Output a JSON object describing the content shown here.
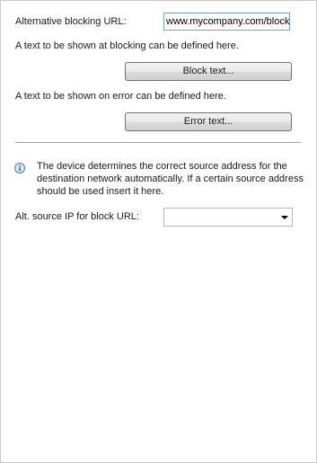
{
  "alt_blocking_url": {
    "label": "Alternative blocking URL:",
    "value": "www.mycompany.com/block"
  },
  "block_section": {
    "description": "A text to be shown at blocking can be defined here.",
    "button_label": "Block text..."
  },
  "error_section": {
    "description": "A text to be shown on error can be defined here.",
    "button_label": "Error text..."
  },
  "info": {
    "icon": "info-icon",
    "text": "The device determines the correct source address for the destination network automatically. If a certain source address should be used insert it here."
  },
  "alt_source_ip": {
    "label": "Alt. source IP for block URL:",
    "selected": ""
  }
}
